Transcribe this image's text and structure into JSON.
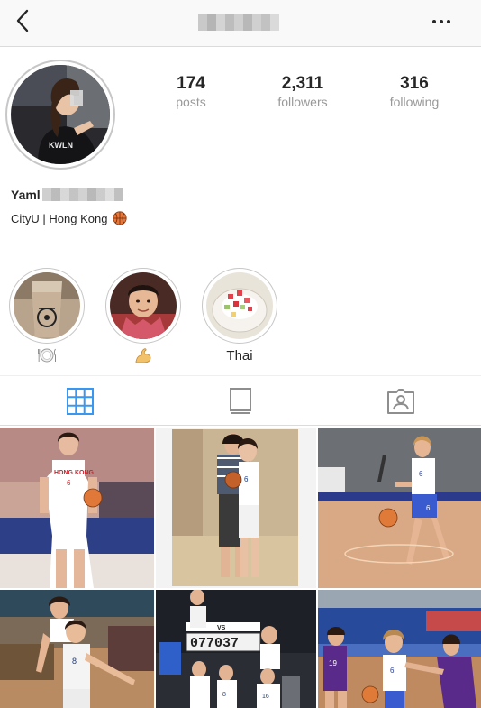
{
  "header": {
    "back_icon": "chevron-left-icon",
    "more_icon": "more-horizontal-icon"
  },
  "profile": {
    "avatar_label": "avatar",
    "stats": [
      {
        "value": "174",
        "label": "posts"
      },
      {
        "value": "2,311",
        "label": "followers"
      },
      {
        "value": "316",
        "label": "following"
      }
    ],
    "name_visible": "Yaml",
    "bio_text": "CityU | Hong Kong",
    "bio_emoji": "basketball-icon"
  },
  "highlights": [
    {
      "label": "🍽",
      "icon": "plate-cutlery-icon"
    },
    {
      "label": "💪",
      "icon": "flexed-biceps-icon"
    },
    {
      "label": "Thai",
      "icon": ""
    }
  ],
  "tabs": [
    {
      "icon": "grid-icon",
      "active": true
    },
    {
      "icon": "feed-list-icon",
      "active": false
    },
    {
      "icon": "tagged-person-icon",
      "active": false
    }
  ],
  "colors": {
    "accent_blue": "#3897f0",
    "text": "#262626",
    "muted": "#999999",
    "border": "#dbdbdb"
  }
}
